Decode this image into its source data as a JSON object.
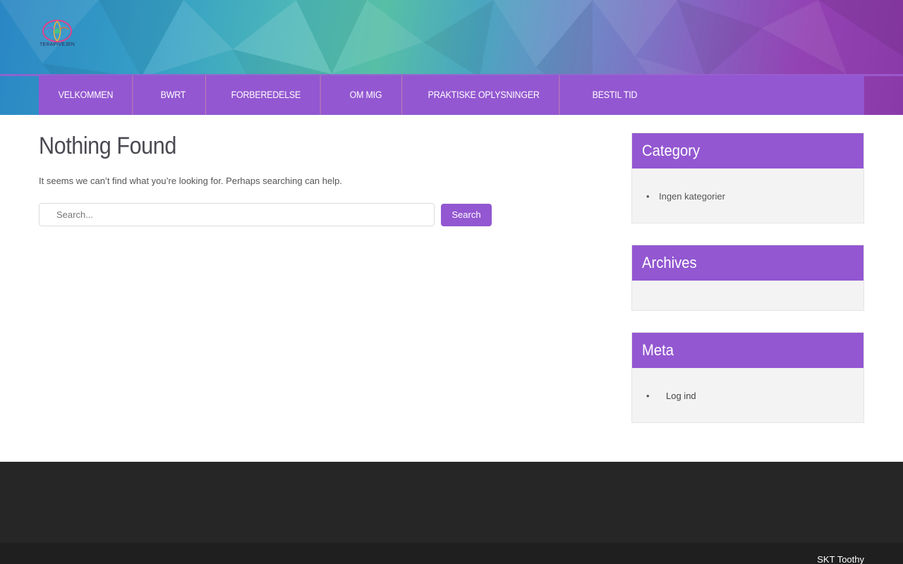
{
  "site": {
    "logo_text": "TERAPIVEJEN"
  },
  "nav": {
    "items": [
      {
        "label": "VELKOMMEN"
      },
      {
        "label": "BWRT"
      },
      {
        "label": "FORBEREDELSE"
      },
      {
        "label": "OM MIG"
      },
      {
        "label": "PRAKTISKE OPLYSNINGER"
      },
      {
        "label": "BESTIL TID"
      }
    ]
  },
  "main": {
    "title": "Nothing Found",
    "intro": "It seems we can’t find what you’re looking for. Perhaps searching can help.",
    "search": {
      "placeholder": "Search...",
      "button_label": "Search"
    }
  },
  "sidebar": {
    "category": {
      "title": "Category",
      "items": [
        "Ingen kategorier"
      ]
    },
    "archives": {
      "title": "Archives"
    },
    "meta": {
      "title": "Meta",
      "items": [
        "Log ind"
      ]
    }
  },
  "footer": {
    "credit": "SKT Toothy"
  },
  "colors": {
    "accent": "#9357d1",
    "footer": "#262626"
  }
}
